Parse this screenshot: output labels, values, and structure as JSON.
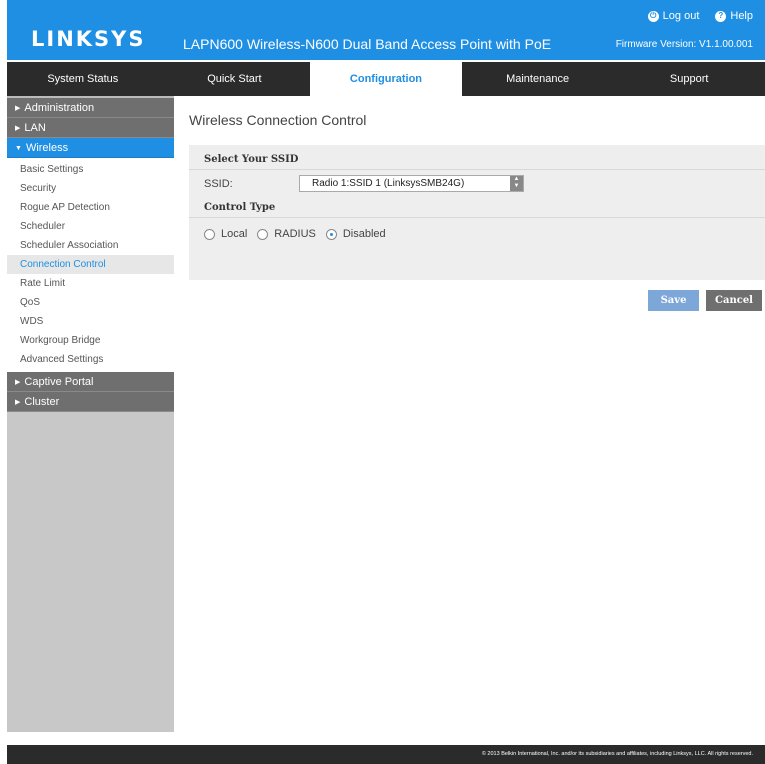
{
  "header": {
    "logo": "LINKSYS",
    "product": "LAPN600 Wireless-N600 Dual Band Access Point with PoE",
    "logout": "Log out",
    "help": "Help",
    "firmware": "Firmware Version: V1.1.00.001",
    "color": "#1f8fe3"
  },
  "tabs": [
    "System Status",
    "Quick Start",
    "Configuration",
    "Maintenance",
    "Support"
  ],
  "active_tab": "Configuration",
  "sidebar": {
    "administration": "Administration",
    "lan": "LAN",
    "wireless": "Wireless",
    "wireless_items": [
      "Basic Settings",
      "Security",
      "Rogue AP Detection",
      "Scheduler",
      "Scheduler Association",
      "Connection Control",
      "Rate Limit",
      "QoS",
      "WDS",
      "Workgroup Bridge",
      "Advanced Settings"
    ],
    "active_item": "Connection Control",
    "captive_portal": "Captive Portal",
    "cluster": "Cluster"
  },
  "main": {
    "title": "Wireless Connection Control",
    "ssid_section": "Select Your SSID",
    "ssid_label": "SSID:",
    "ssid_value": "Radio 1:SSID 1 (LinksysSMB24G)",
    "control_section": "Control Type",
    "radios": [
      "Local",
      "RADIUS",
      "Disabled"
    ],
    "selected_radio": "Disabled"
  },
  "buttons": {
    "save": "Save",
    "cancel": "Cancel"
  },
  "footer": "© 2013 Belkin International, Inc. and/or its subsidiaries and affiliates, including Linksys, LLC. All rights reserved."
}
